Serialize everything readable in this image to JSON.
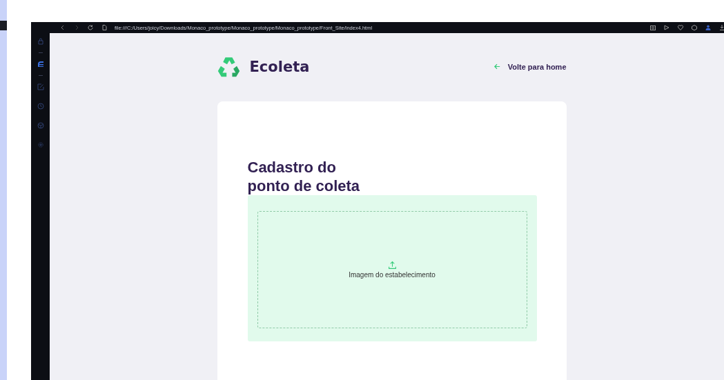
{
  "sidebar": {
    "items": [
      {
        "kind": "bag",
        "selected": false
      },
      {
        "kind": "logo",
        "selected": true
      },
      {
        "kind": "edit",
        "selected": false
      },
      {
        "kind": "clock",
        "selected": false
      },
      {
        "kind": "box",
        "selected": false
      },
      {
        "kind": "gear",
        "selected": false
      }
    ]
  },
  "address_bar": {
    "url": "file:///C:/Users/joicy/Downloads/Monaco_prototype/Monaco_prototype/Monaco_prototype/Front_Site/index4.html"
  },
  "header": {
    "brand": "Ecoleta",
    "back_link": "Volte para home"
  },
  "form": {
    "title": "Cadastro do ponto de coleta",
    "dropzone": {
      "label": "Imagem do estabelecimento"
    }
  }
}
